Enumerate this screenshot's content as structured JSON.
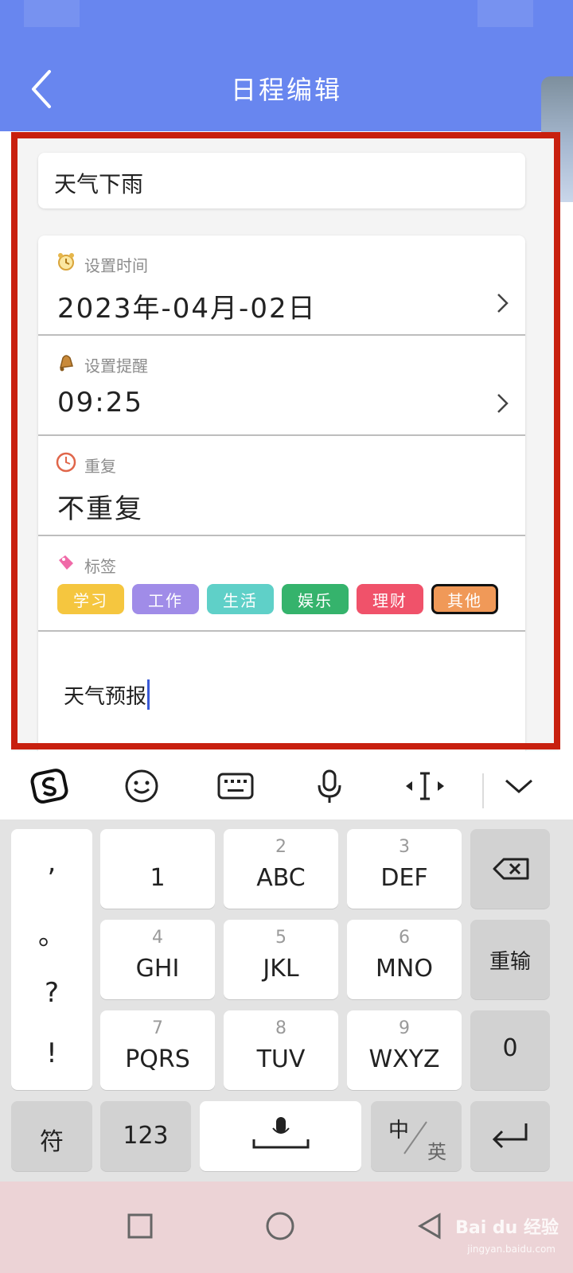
{
  "header": {
    "title": "日程编辑"
  },
  "event": {
    "title": "天气下雨",
    "note": "天气预报"
  },
  "settings": {
    "time": {
      "label": "设置时间",
      "value": "2023年-04月-02日"
    },
    "reminder": {
      "label": "设置提醒",
      "value": "09:25"
    },
    "repeat": {
      "label": "重复",
      "value": "不重复"
    },
    "tags": {
      "label": "标签",
      "items": [
        {
          "label": "学习",
          "color": "#f5c63f"
        },
        {
          "label": "工作",
          "color": "#a08ce8"
        },
        {
          "label": "生活",
          "color": "#5fd0c8"
        },
        {
          "label": "娱乐",
          "color": "#35b36c"
        },
        {
          "label": "理财",
          "color": "#f0526a"
        },
        {
          "label": "其他",
          "color": "#f09958"
        }
      ],
      "selected": "其他"
    }
  },
  "icons": {
    "toolbar": [
      "sogou-logo-icon",
      "emoji-icon",
      "keyboard-icon",
      "microphone-icon",
      "cursor-move-icon",
      "chevron-down-icon"
    ]
  },
  "keyboard": {
    "punctuation": [
      ",",
      "。",
      "?",
      "!"
    ],
    "keys": {
      "k1": {
        "number": "",
        "letters": "1"
      },
      "k2": {
        "number": "2",
        "letters": "ABC"
      },
      "k3": {
        "number": "3",
        "letters": "DEF"
      },
      "k4": {
        "number": "4",
        "letters": "GHI"
      },
      "k5": {
        "number": "5",
        "letters": "JKL"
      },
      "k6": {
        "number": "6",
        "letters": "MNO"
      },
      "k7": {
        "number": "7",
        "letters": "PQRS"
      },
      "k8": {
        "number": "8",
        "letters": "TUV"
      },
      "k9": {
        "number": "9",
        "letters": "WXYZ"
      }
    },
    "reenter": "重输",
    "zero": "0",
    "symbols": "符",
    "numbers": "123",
    "lang_zh": "中",
    "lang_en": "英"
  },
  "watermark": {
    "brand": "Bai du 经验",
    "url": "jingyan.baidu.com"
  },
  "colors": {
    "header": "#6886ef",
    "highlight": "#c8200f",
    "navbar": "#ecd3d6"
  }
}
